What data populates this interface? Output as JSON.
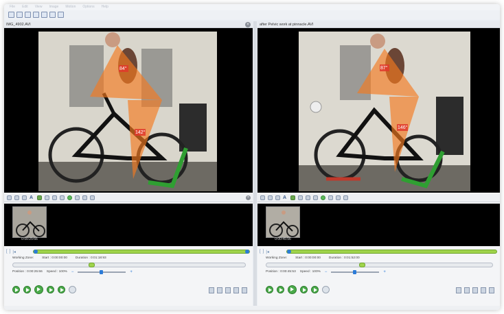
{
  "menubar": {
    "items": [
      "File",
      "Edit",
      "View",
      "Image",
      "Motion",
      "Options",
      "Help"
    ]
  },
  "left_pane": {
    "title": "IMG_4902.AVI",
    "angles": {
      "upper": "84°",
      "lower": "142°"
    },
    "thumbnail_time": "0:00:25:66",
    "working_zone": "Working Zone:",
    "start": "Start : 0:00:00:00",
    "duration": "Duration : 0:01:18:93",
    "position": "Position : 0:00:25:66",
    "speed": "Speed : 100%",
    "speed_minus": "−",
    "speed_plus": "+"
  },
  "right_pane": {
    "title": "after Pelvic work at pinnacle.AVI",
    "angles": {
      "upper": "87°",
      "lower": "146°"
    },
    "thumbnail_time": "0:00:45:56",
    "working_zone": "Working Zone:",
    "start": "Start : 0:00:00:00",
    "duration": "Duration : 0:01:52:00",
    "position": "Position : 0:00:45:53",
    "speed": "Speed : 100%",
    "speed_minus": "−",
    "speed_plus": "+"
  },
  "colors": {
    "angle_fill": "#f47a1e",
    "timeline": "#9fd34b",
    "accent": "#2b7bd8"
  }
}
